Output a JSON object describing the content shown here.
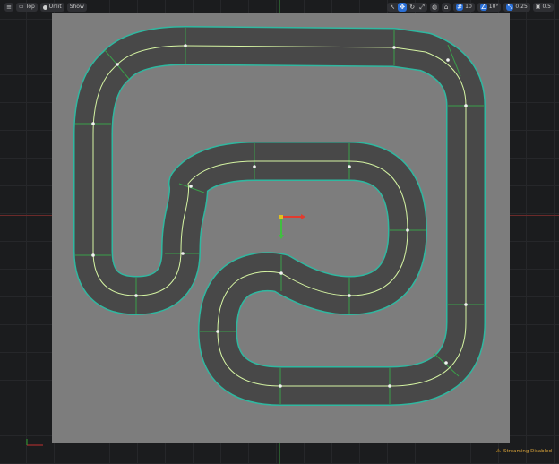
{
  "viewport": {
    "view_mode_label": "Top",
    "lit_mode_label": "Unlit",
    "show_label": "Show"
  },
  "toolbar_right": {
    "grid_size": "10",
    "rotation_snap": "10°",
    "scale_snap": "0.25",
    "camera_speed": "0.5"
  },
  "status": {
    "message": "Streaming Disabled"
  },
  "icons": {
    "menu": "hamburger-icon",
    "view": "viewport-type-icon",
    "lit": "lit-sphere-icon",
    "select": "select-arrow-icon",
    "translate": "translate-icon",
    "rotate": "rotate-icon",
    "scale": "scale-icon",
    "world": "globe-icon",
    "surface_snap": "surface-snap-icon",
    "grid_snap": "grid-snap-icon",
    "rotation_snap": "rotation-snap-icon",
    "scale_snap": "scale-snap-icon",
    "camera": "camera-speed-icon",
    "warning": "warning-icon"
  },
  "colors": {
    "track_fill": "#484848",
    "track_outline": "#2fb8a0",
    "spline": "#d6f5a3",
    "ground": "#7d7d7d",
    "accent": "#2a6fd6",
    "warning": "#d7a23a"
  }
}
